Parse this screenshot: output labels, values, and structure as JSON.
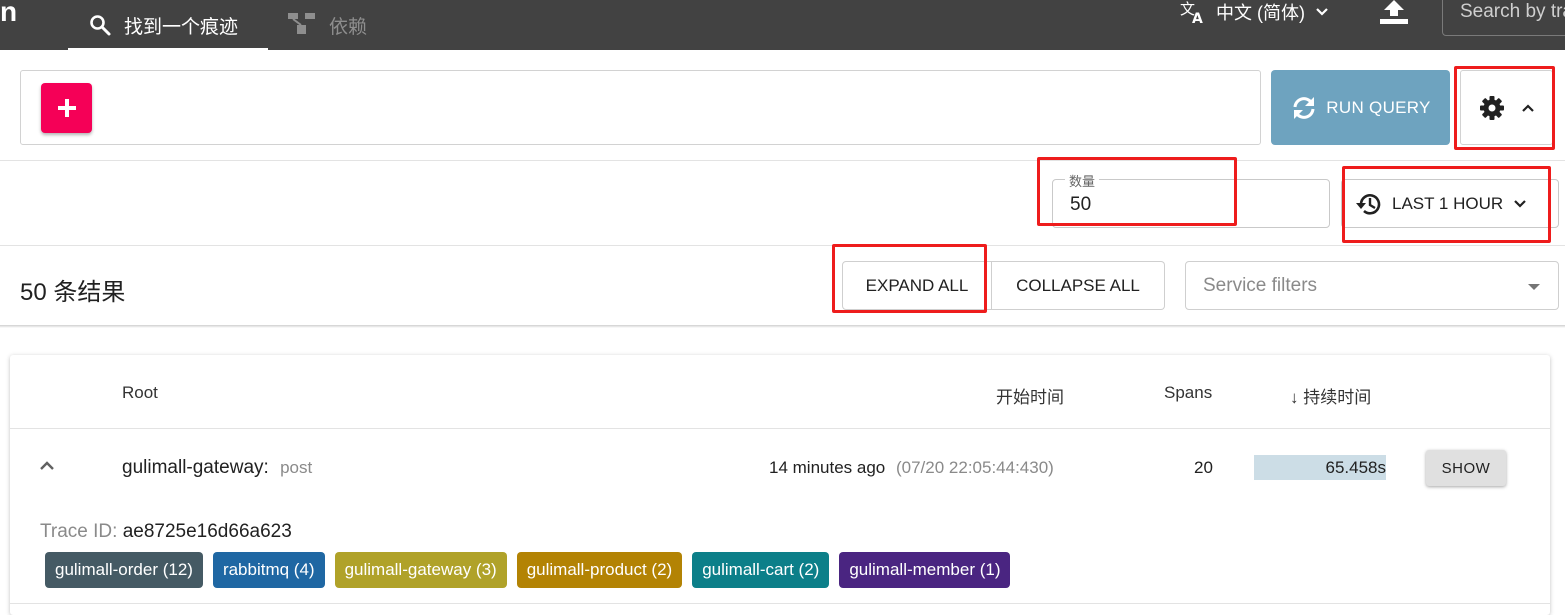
{
  "appbar": {
    "logo": "n",
    "tabs": [
      {
        "label": "找到一个痕迹",
        "icon": "search-icon",
        "active": true
      },
      {
        "label": "依赖",
        "icon": "dependencies-icon",
        "active": false
      }
    ],
    "language": {
      "label": "中文 (简体)",
      "icon": "translate-icon"
    },
    "upload_icon": "upload-icon",
    "search_placeholder": "Search by trace ID"
  },
  "query": {
    "add_button_icon": "plus-icon",
    "run_button_label": "RUN QUERY",
    "settings_icon": "gear-icon"
  },
  "options": {
    "limit_label": "数量",
    "limit_value": "50",
    "time_range_label": "LAST 1 HOUR"
  },
  "results": {
    "count_label": "50 条结果",
    "expand_all_label": "EXPAND ALL",
    "collapse_all_label": "COLLAPSE ALL",
    "service_filter_placeholder": "Service filters"
  },
  "table": {
    "columns": {
      "root": "Root",
      "start_time": "开始时间",
      "spans": "Spans",
      "duration": "持续时间"
    },
    "sort_indicator": "↓",
    "rows": [
      {
        "service": "gulimall-gateway:",
        "operation": "post",
        "start_relative": "14 minutes ago",
        "start_absolute": "(07/20 22:05:44:430)",
        "spans": "20",
        "duration": "65.458s",
        "duration_fraction": 1.0,
        "show_label": "SHOW",
        "trace_id_label": "Trace ID:",
        "trace_id": "ae8725e16d66a623",
        "service_chips": [
          {
            "label": "gulimall-order (12)",
            "color": "#455a64"
          },
          {
            "label": "rabbitmq (4)",
            "color": "#1f67a3"
          },
          {
            "label": "gulimall-gateway (3)",
            "color": "#b0a229"
          },
          {
            "label": "gulimall-product (2)",
            "color": "#b38304"
          },
          {
            "label": "gulimall-cart (2)",
            "color": "#0c7f89"
          },
          {
            "label": "gulimall-member (1)",
            "color": "#4a2581"
          }
        ]
      }
    ]
  },
  "colors": {
    "appbar": "#424242",
    "add_button": "#f50057",
    "run_button": "#6ea3bf",
    "duration_bar": "#ccdde6",
    "annotation": "#ee1c1c"
  }
}
